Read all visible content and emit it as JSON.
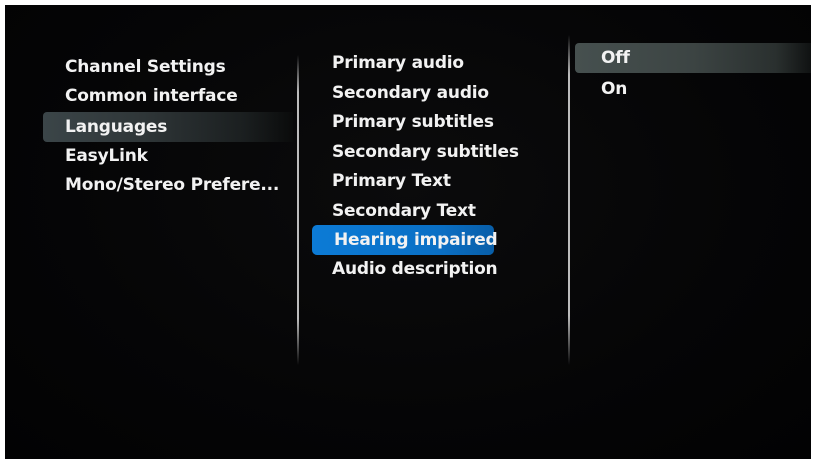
{
  "menu": {
    "left": {
      "items": [
        "Channel Settings",
        "Common interface",
        "Languages",
        "EasyLink",
        "Mono/Stereo Prefere..."
      ],
      "selected": "Languages"
    },
    "middle": {
      "items": [
        "Primary audio",
        "Secondary audio",
        "Primary subtitles",
        "Secondary subtitles",
        "Primary Text",
        "Secondary Text",
        "Hearing impaired",
        "Audio description"
      ],
      "selected": "Hearing impaired"
    },
    "right": {
      "items": [
        "Off",
        "On"
      ],
      "selected": "Off"
    }
  },
  "colors": {
    "background": "#050506",
    "text": "#f2f2f2",
    "focus_highlight": "#0c7bd6",
    "path_highlight": "#3b4548"
  }
}
